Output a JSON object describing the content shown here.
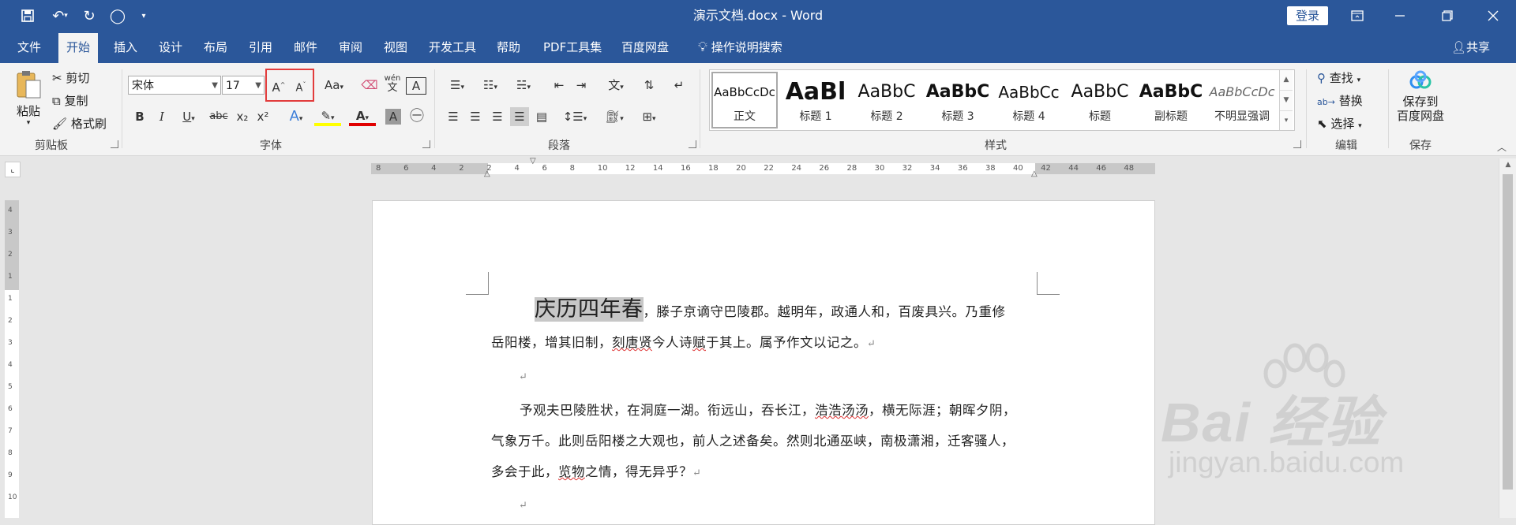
{
  "window": {
    "title": "演示文档.docx - Word",
    "login_label": "登录"
  },
  "quick_access": {
    "icons": [
      "save-icon",
      "undo-icon",
      "redo-icon",
      "circle-icon",
      "customize-icon"
    ]
  },
  "tabs": [
    "文件",
    "开始",
    "插入",
    "设计",
    "布局",
    "引用",
    "邮件",
    "审阅",
    "视图",
    "开发工具",
    "帮助",
    "PDF工具集",
    "百度网盘"
  ],
  "active_tab": "开始",
  "tell_me": "操作说明搜索",
  "share": "共享",
  "clipboard": {
    "paste": "粘贴",
    "cut": "剪切",
    "copy": "复制",
    "format_painter": "格式刷",
    "label": "剪贴板"
  },
  "font": {
    "name": "宋体",
    "size": "17",
    "label": "字体",
    "grow_icon": "A",
    "shrink_icon": "A",
    "case_label": "Aa",
    "bold": "B",
    "italic": "I",
    "underline": "U",
    "strike": "abc",
    "sub": "x₂",
    "sup": "x²",
    "phonetic": "wén"
  },
  "paragraph": {
    "label": "段落"
  },
  "styles": {
    "label": "样式",
    "items": [
      {
        "sample": "AaBbCcDc",
        "name": "正文"
      },
      {
        "sample": "AaBl",
        "name": "标题 1"
      },
      {
        "sample": "AaBbC",
        "name": "标题 2"
      },
      {
        "sample": "AaBbC",
        "name": "标题 3"
      },
      {
        "sample": "AaBbCc",
        "name": "标题 4"
      },
      {
        "sample": "AaBbC",
        "name": "标题"
      },
      {
        "sample": "AaBbC",
        "name": "副标题"
      },
      {
        "sample": "AaBbCcDc",
        "name": "不明显强调"
      }
    ]
  },
  "editing": {
    "find": "查找",
    "replace": "替换",
    "select": "选择",
    "label": "编辑"
  },
  "save": {
    "line1": "保存到",
    "line2": "百度网盘",
    "label": "保存"
  },
  "ruler_numbers": [
    "8",
    "6",
    "4",
    "2",
    "2",
    "4",
    "6",
    "8",
    "10",
    "12",
    "14",
    "16",
    "18",
    "20",
    "22",
    "24",
    "26",
    "28",
    "30",
    "32",
    "34",
    "36",
    "38",
    "40",
    "42",
    "44",
    "46",
    "48"
  ],
  "document": {
    "p1_big": "庆历四年春",
    "p1_rest": "，滕子京谪守巴陵郡。越明年，政通人和，百废具兴。乃重修",
    "p1_line2a": "岳阳楼，增其旧制，",
    "p1_line2b": "刻唐贤",
    "p1_line2c": "今人诗",
    "p1_line2d": "赋",
    "p1_line2e": "于其上。属予作文以记之。",
    "mark": "↵",
    "p2_line1a": "予观夫巴陵胜状，在洞庭一湖。衔远山，吞长江，",
    "p2_line1b": "浩浩汤汤",
    "p2_line1c": "，横无际涯；朝晖夕阴，",
    "p2_line2": "气象万千。此则岳阳楼之大观也，前人之述备矣。然则北通巫峡，南极潇湘，迁客骚人，",
    "p2_line3a": "多会于此，",
    "p2_line3b": "览物",
    "p2_line3c": "之情，得无异乎？"
  },
  "watermark": {
    "brand": "Bai 经验",
    "url": "jingyan.baidu.com"
  }
}
